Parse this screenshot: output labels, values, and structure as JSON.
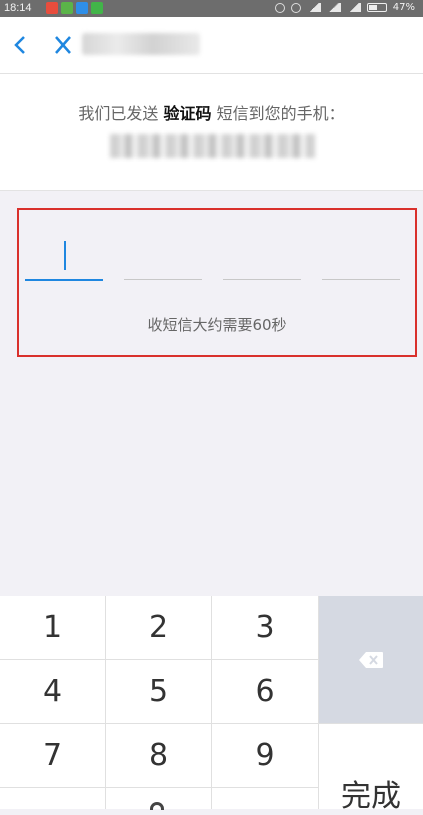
{
  "status_bar": {
    "time": "18:14",
    "battery": "47%",
    "app_icon_colors": [
      "#e84d3d",
      "#5bb449",
      "#2f8fe8",
      "#42b549"
    ]
  },
  "header": {
    "back_icon": "‹",
    "close_icon": "✕"
  },
  "message": {
    "prefix": "我们已发送",
    "emphasis": "验证码",
    "suffix": "短信到您的手机："
  },
  "code_input": {
    "digits": [
      "",
      "",
      "",
      ""
    ],
    "hint": "收短信大约需要60秒"
  },
  "keypad": {
    "keys": [
      "1",
      "2",
      "3",
      "4",
      "5",
      "6",
      "7",
      "8",
      "9"
    ],
    "delete_icon": "backspace-icon",
    "done_label": "完成"
  },
  "colors": {
    "accent": "#1f87e0",
    "highlight_border": "#d9302c",
    "delete_key_bg": "#d5d9e2"
  }
}
